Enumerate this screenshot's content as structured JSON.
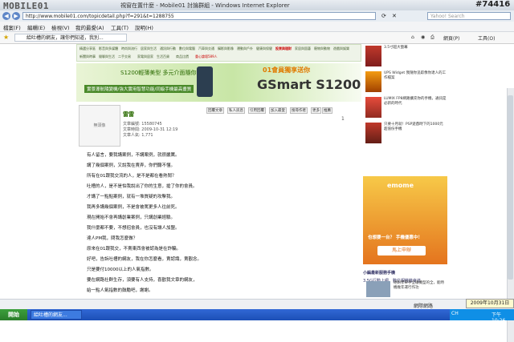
{
  "window": {
    "logo_text": "MOBILE01",
    "title": "視窗在置什麼 - Mobile01 討論群組 - Windows Internet Explorer",
    "watermark": "#74416"
  },
  "address": {
    "url": "http://www.mobile01.com/topicdetail.php?f=291&t=1288755",
    "search_placeholder": "Yahoo! Search"
  },
  "menus": [
    "檔案(F)",
    "編輯(E)",
    "檢視(V)",
    "我的最愛(A)",
    "工具(T)",
    "說明(H)"
  ],
  "tab": {
    "label": "給吐槽的網友，讓你們知道，我別..."
  },
  "toolbar": {
    "page": "網頁(P)",
    "tools": "工具(O)"
  },
  "site_nav": [
    "精選分享區",
    "影音與多媒體",
    "時尚與流行",
    "居家與生活",
    "通訊與行動",
    "數位與電腦",
    "汽車與交通",
    "攝影與影像",
    "運動與戶外",
    "健康與保健",
    "家居與園藝",
    "寵物與動物",
    "投資與理財",
    "遊戲與娛樂",
    "新聞與時事",
    "閒聊與生活",
    "二手交易",
    "家電與居家",
    "生活百貨",
    "商品比價",
    "重心論壇589人"
  ],
  "banner": {
    "line1": "S1200輕薄美型 多元介面隨你行",
    "line2": "實景導航隨變機/強大實用智慧功能/同級手機最高畫質",
    "promo": "01會員獨享送你",
    "brand": "GSmart S1200"
  },
  "post": {
    "username": "雷雷",
    "avatar_label": "無頭像",
    "stats": [
      "文章編號: 15580745",
      "文章時間: 2009-10-31 12:19",
      "文章人氣: 1,771"
    ],
    "actions": [
      "回覆文章",
      "私人訊息",
      "引用回覆",
      "加入最愛",
      "搜尋作者",
      "更多",
      "推薦"
    ],
    "page_num": "1",
    "lines": [
      "有人留言，要我講案例，不講案例，就很嚴厲。",
      "講了幾個案例，又說我在賣弄，你們聽不懂。",
      "所有在01跟我交流的人，是不是都在看熱鬧？",
      "吐槽的人，是不是怕我說出了你的生意，搶了你的會員。",
      "才講了一點點案例，就有一堆質疑的攻擊我。",
      "我再多講幾個案例，不是會被罵更多人往前死。",
      "現在開始不會再講創業案例，只講創業經驗。",
      "我什麼都不要，不想招會員，也沒有讓人加盟。",
      "達人PM我，問我怎麼做？",
      "原來在01跟我交，不賣東西會被認為是在詐騙。",
      "好吧，告訴吐槽的網友，我在你怎麼看，賣認識，賣觀念。",
      "只是要付10000以上的人氣指數。",
      "要在網路社群生存，須要有人支持，喜歡我文章的網友，",
      "給一點人氣指數的鼓勵吧，謝謝。"
    ]
  },
  "sidebar": {
    "items": [
      "3.5寸超大螢幕",
      "UPS Widget 我隨你追踪像你達人的工作檔案",
      "LUMIX FP8網路擴充你的手機，通訊是必新的時代",
      "只要十月就！PSP遊戲時下的1000元超值份手機"
    ],
    "emome_logo": "emome",
    "emome_text": "也想要一台？  手機優惠中！",
    "emome_button": "馬上申辦",
    "heading": "小編最新服務手機",
    "news_title": "3.5G行動上網、數位相機機會達",
    "news_text": "絕對學單手全穩機型的全，能時機幾年運行作功"
  },
  "status": {
    "zone": "網際網路",
    "zoom": "100%",
    "date_badge": "2009年10月31日"
  },
  "taskbar": {
    "start": "開始",
    "task": "給吐槽的網友...",
    "ime": "CH",
    "clock": "下午 10:26"
  }
}
